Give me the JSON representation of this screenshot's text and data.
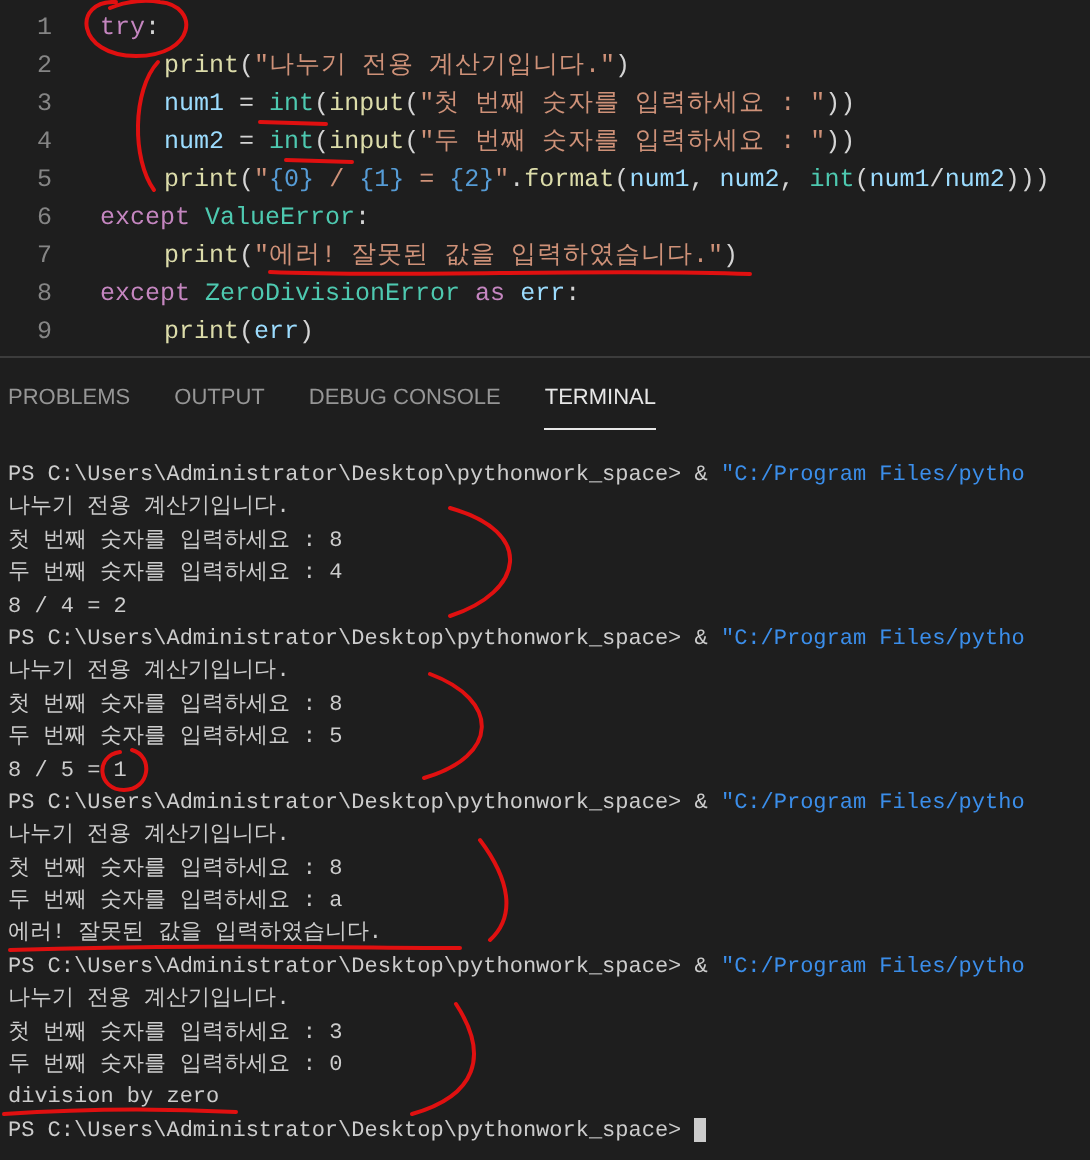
{
  "editor": {
    "lines": [
      {
        "number": "1",
        "tokens": [
          {
            "text": "try",
            "kind": "keyword"
          },
          {
            "text": ":",
            "kind": "plain"
          }
        ],
        "children": [
          {
            "number": "2",
            "tokens": [
              {
                "text": "print",
                "kind": "function"
              },
              {
                "text": "(",
                "kind": "plain"
              },
              {
                "text": "\"나누기 전용 계산기입니다.\"",
                "kind": "string"
              },
              {
                "text": ")",
                "kind": "plain"
              }
            ]
          },
          {
            "number": "3",
            "tokens": [
              {
                "text": "num1",
                "kind": "variable"
              },
              {
                "text": " = ",
                "kind": "plain"
              },
              {
                "text": "int",
                "kind": "builtin"
              },
              {
                "text": "(",
                "kind": "plain"
              },
              {
                "text": "input",
                "kind": "function"
              },
              {
                "text": "(",
                "kind": "plain"
              },
              {
                "text": "\"첫 번째 숫자를 입력하세요 : \"",
                "kind": "string"
              },
              {
                "text": "))",
                "kind": "plain"
              }
            ]
          },
          {
            "number": "4",
            "tokens": [
              {
                "text": "num2",
                "kind": "variable"
              },
              {
                "text": " = ",
                "kind": "plain"
              },
              {
                "text": "int",
                "kind": "builtin"
              },
              {
                "text": "(",
                "kind": "plain"
              },
              {
                "text": "input",
                "kind": "function"
              },
              {
                "text": "(",
                "kind": "plain"
              },
              {
                "text": "\"두 번째 숫자를 입력하세요 : \"",
                "kind": "string"
              },
              {
                "text": "))",
                "kind": "plain"
              }
            ]
          },
          {
            "number": "5",
            "tokens": [
              {
                "text": "print",
                "kind": "function"
              },
              {
                "text": "(",
                "kind": "plain"
              },
              {
                "text": "\"",
                "kind": "string"
              },
              {
                "text": "{0}",
                "kind": "placeholder"
              },
              {
                "text": " / ",
                "kind": "string"
              },
              {
                "text": "{1}",
                "kind": "placeholder"
              },
              {
                "text": " = ",
                "kind": "string"
              },
              {
                "text": "{2}",
                "kind": "placeholder"
              },
              {
                "text": "\"",
                "kind": "string"
              },
              {
                "text": ".",
                "kind": "plain"
              },
              {
                "text": "format",
                "kind": "function"
              },
              {
                "text": "(",
                "kind": "plain"
              },
              {
                "text": "num1",
                "kind": "variable"
              },
              {
                "text": ", ",
                "kind": "plain"
              },
              {
                "text": "num2",
                "kind": "variable"
              },
              {
                "text": ", ",
                "kind": "plain"
              },
              {
                "text": "int",
                "kind": "builtin"
              },
              {
                "text": "(",
                "kind": "plain"
              },
              {
                "text": "num1",
                "kind": "variable"
              },
              {
                "text": "/",
                "kind": "plain"
              },
              {
                "text": "num2",
                "kind": "variable"
              },
              {
                "text": ")))",
                "kind": "plain"
              }
            ]
          }
        ]
      },
      {
        "number": "6",
        "tokens": [
          {
            "text": "except ",
            "kind": "keyword"
          },
          {
            "text": "ValueError",
            "kind": "builtin"
          },
          {
            "text": ":",
            "kind": "plain"
          }
        ],
        "children": [
          {
            "number": "7",
            "tokens": [
              {
                "text": "print",
                "kind": "function"
              },
              {
                "text": "(",
                "kind": "plain"
              },
              {
                "text": "\"에러! 잘못된 값을 입력하였습니다.\"",
                "kind": "string"
              },
              {
                "text": ")",
                "kind": "plain"
              }
            ]
          }
        ]
      },
      {
        "number": "8",
        "tokens": [
          {
            "text": "except ",
            "kind": "keyword"
          },
          {
            "text": "ZeroDivisionError ",
            "kind": "builtin"
          },
          {
            "text": "as ",
            "kind": "keyword"
          },
          {
            "text": "err",
            "kind": "variable"
          },
          {
            "text": ":",
            "kind": "plain"
          }
        ],
        "children": [
          {
            "number": "9",
            "tokens": [
              {
                "text": "print",
                "kind": "function"
              },
              {
                "text": "(",
                "kind": "plain"
              },
              {
                "text": "err",
                "kind": "variable"
              },
              {
                "text": ")",
                "kind": "plain"
              }
            ]
          }
        ]
      }
    ]
  },
  "panel": {
    "tabs": [
      {
        "label": "PROBLEMS",
        "selected": false
      },
      {
        "label": "OUTPUT",
        "selected": false
      },
      {
        "label": "DEBUG CONSOLE",
        "selected": false
      },
      {
        "label": "TERMINAL",
        "selected": true
      }
    ]
  },
  "terminal": {
    "lines": [
      {
        "kind": "command",
        "prompt": "PS C:\\Users\\Administrator\\Desktop\\pythonwork_space> & ",
        "command": "\"C:/Program Files/pytho"
      },
      {
        "kind": "output",
        "text": "나누기 전용 계산기입니다."
      },
      {
        "kind": "output",
        "text": "첫 번째 숫자를 입력하세요 : 8"
      },
      {
        "kind": "output",
        "text": "두 번째 숫자를 입력하세요 : 4"
      },
      {
        "kind": "output",
        "text": "8 / 4 = 2"
      },
      {
        "kind": "command",
        "prompt": "PS C:\\Users\\Administrator\\Desktop\\pythonwork_space> & ",
        "command": "\"C:/Program Files/pytho"
      },
      {
        "kind": "output",
        "text": "나누기 전용 계산기입니다."
      },
      {
        "kind": "output",
        "text": "첫 번째 숫자를 입력하세요 : 8"
      },
      {
        "kind": "output",
        "text": "두 번째 숫자를 입력하세요 : 5"
      },
      {
        "kind": "output",
        "text": "8 / 5 = 1"
      },
      {
        "kind": "command",
        "prompt": "PS C:\\Users\\Administrator\\Desktop\\pythonwork_space> & ",
        "command": "\"C:/Program Files/pytho"
      },
      {
        "kind": "output",
        "text": "나누기 전용 계산기입니다."
      },
      {
        "kind": "output",
        "text": "첫 번째 숫자를 입력하세요 : 8"
      },
      {
        "kind": "output",
        "text": "두 번째 숫자를 입력하세요 : a"
      },
      {
        "kind": "output",
        "text": "에러! 잘못된 값을 입력하였습니다."
      },
      {
        "kind": "command",
        "prompt": "PS C:\\Users\\Administrator\\Desktop\\pythonwork_space> & ",
        "command": "\"C:/Program Files/pytho"
      },
      {
        "kind": "output",
        "text": "나누기 전용 계산기입니다."
      },
      {
        "kind": "output",
        "text": "첫 번째 숫자를 입력하세요 : 3"
      },
      {
        "kind": "output",
        "text": "두 번째 숫자를 입력하세요 : 0"
      },
      {
        "kind": "output",
        "text": "division by zero"
      },
      {
        "kind": "prompt",
        "prompt": "PS C:\\Users\\Administrator\\Desktop\\pythonwork_space> "
      }
    ]
  }
}
